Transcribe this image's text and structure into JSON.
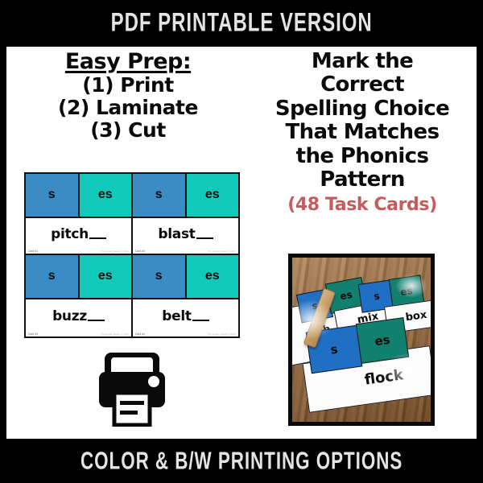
{
  "banners": {
    "top": "PDF PRINTABLE VERSION",
    "bottom": "COLOR & B/W PRINTING OPTIONS"
  },
  "colors": {
    "background": "#000000",
    "panel": "#ffffff",
    "text": "#0b0b0b",
    "banner_text": "#e4e4e4",
    "choice_blue": "#3b8bc4",
    "choice_teal": "#11c9b8",
    "accent_red": "#c65b5b",
    "card_border": "#111111"
  },
  "left_column": {
    "title": "Easy Prep:",
    "steps": [
      "(1) Print",
      "(2) Laminate",
      "(3) Cut"
    ],
    "printer_icon": "printer-icon"
  },
  "right_column": {
    "heading_lines": [
      "Mark the",
      "Correct",
      "Spelling Choice",
      "That Matches",
      "the Phonics",
      "Pattern"
    ],
    "task_count": "(48 Task Cards)"
  },
  "card_grid": {
    "choice_a_label": "s",
    "choice_b_label": "es",
    "cards": [
      {
        "word": "pitch",
        "number": "Card #1",
        "credit": "The Jordan Reads © 2021",
        "choice_a": "s",
        "choice_b": "es"
      },
      {
        "word": "blast",
        "number": "Card #2",
        "credit": "The Jordan Reads © 2021",
        "choice_a": "s",
        "choice_b": "es"
      },
      {
        "word": "buzz",
        "number": "Card #3",
        "credit": "The Jordan Reads © 2021",
        "choice_a": "s",
        "choice_b": "es"
      },
      {
        "word": "belt",
        "number": "Card #4",
        "credit": "The Jordan Reads © 2021",
        "choice_a": "s",
        "choice_b": "es"
      }
    ]
  },
  "photo": {
    "alt": "task cards with clothespin on wooden table",
    "visible_words": [
      "th",
      "mix",
      "box",
      "flock"
    ],
    "visible_choices": [
      "s",
      "es",
      "s",
      "es",
      "s",
      "es"
    ]
  }
}
